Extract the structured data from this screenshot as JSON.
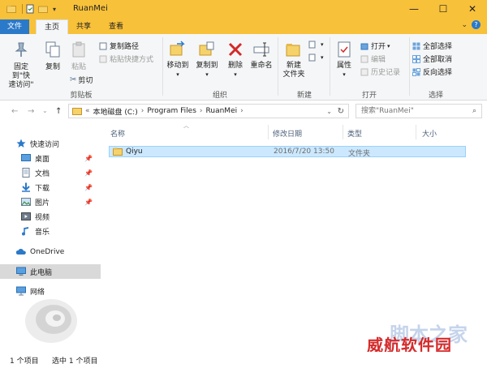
{
  "window": {
    "title": "RuanMei",
    "minimize": "—",
    "maximize": "☐",
    "close": "✕"
  },
  "tabs": {
    "file": "文件",
    "home": "主页",
    "share": "共享",
    "view": "查看"
  },
  "ribbon": {
    "clipboard": {
      "pin_quick": "固定到\"快速访问\"",
      "copy": "复制",
      "paste": "粘贴",
      "copy_path": "复制路径",
      "paste_shortcut": "粘贴快捷方式",
      "cut": "剪切",
      "label": "剪贴板"
    },
    "organize": {
      "move_to": "移动到",
      "copy_to": "复制到",
      "delete": "删除",
      "rename": "重命名",
      "label": "组织"
    },
    "new": {
      "new_folder": "新建\n文件夹",
      "label": "新建"
    },
    "open": {
      "properties": "属性",
      "open": "打开",
      "edit": "编辑",
      "history": "历史记录",
      "label": "打开"
    },
    "select": {
      "select_all": "全部选择",
      "select_none": "全部取消",
      "invert": "反向选择",
      "label": "选择"
    }
  },
  "address": {
    "back": "←",
    "forward": "→",
    "recent": "⌄",
    "up": "↑",
    "overflow": "«",
    "crumbs": [
      "本地磁盘 (C:)",
      "Program Files",
      "RuanMei"
    ],
    "search_placeholder": "搜索\"RuanMei\""
  },
  "nav": {
    "quick_access": "快速访问",
    "desktop": "桌面",
    "documents": "文档",
    "downloads": "下载",
    "pictures": "图片",
    "videos": "视频",
    "music": "音乐",
    "onedrive": "OneDrive",
    "this_pc": "此电脑",
    "network": "网络"
  },
  "columns": {
    "name": "名称",
    "date": "修改日期",
    "type": "类型",
    "size": "大小"
  },
  "files": [
    {
      "name": "Qiyu",
      "date": "2016/7/20 13:50",
      "type": "文件夹",
      "size": ""
    }
  ],
  "status": {
    "count": "1 个项目",
    "selected": "选中 1 个项目"
  },
  "watermark": {
    "text": "威航软件园",
    "bg_text": "脚本之家"
  },
  "colors": {
    "titlebar": "#f8c13a",
    "file_tab": "#2b79c9",
    "selected_row": "#cce8ff"
  }
}
